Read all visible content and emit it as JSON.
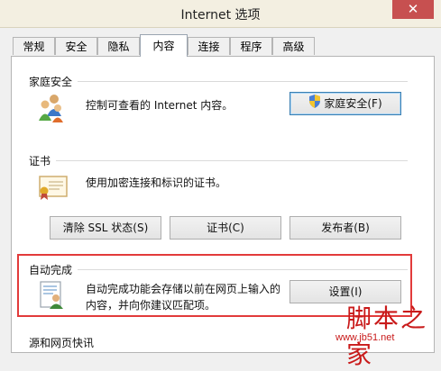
{
  "window": {
    "title": "Internet 选项",
    "close_label": "✕"
  },
  "tabs": [
    "常规",
    "安全",
    "隐私",
    "内容",
    "连接",
    "程序",
    "高级"
  ],
  "sections": {
    "family": {
      "heading": "家庭安全",
      "description": "控制可查看的 Internet 内容。",
      "button": "家庭安全(F)"
    },
    "certificates": {
      "heading": "证书",
      "description": "使用加密连接和标识的证书。",
      "buttons": [
        "清除 SSL 状态(S)",
        "证书(C)",
        "发布者(B)"
      ]
    },
    "autocomplete": {
      "heading": "自动完成",
      "description_line1": "自动完成功能会存储以前在网页上输入的",
      "description_line2": "内容，并向你建议匹配项。",
      "button": "设置(I)"
    },
    "feeds": {
      "heading": "源和网页快讯"
    }
  },
  "watermark": {
    "main": "脚本之家",
    "url": "www.jb51.net"
  },
  "colors": {
    "highlight_box": "#e23b3b",
    "close_button": "#c75050",
    "watermark": "#c91a1a"
  }
}
